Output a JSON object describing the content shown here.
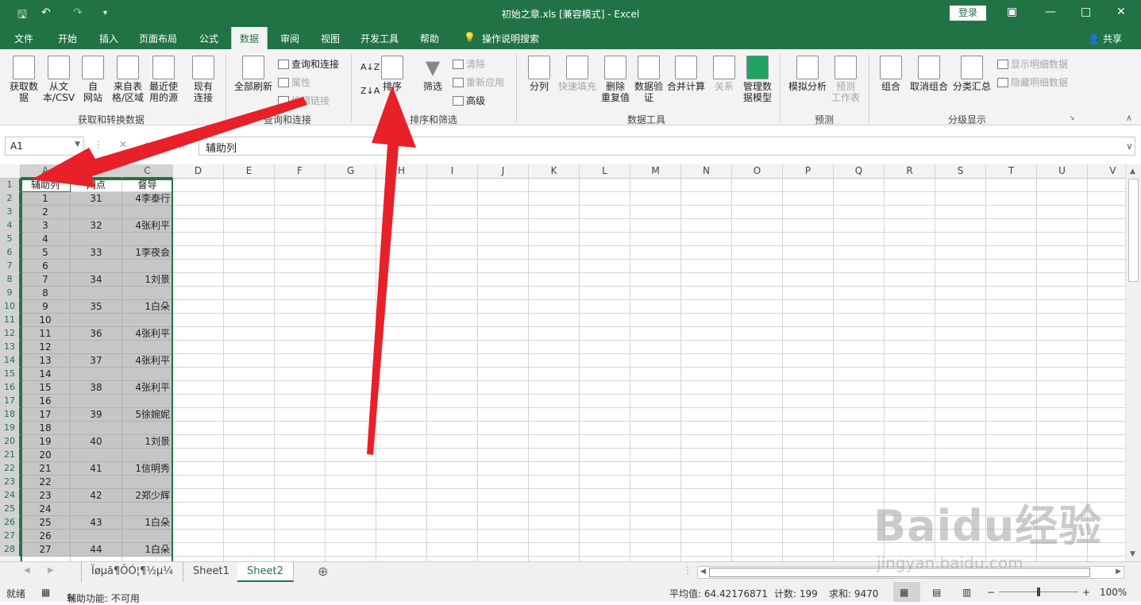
{
  "titlebar": {
    "title": "初始之章.xls  [兼容模式]  -  Excel",
    "login": "登录"
  },
  "tabs": [
    "文件",
    "开始",
    "插入",
    "页面布局",
    "公式",
    "数据",
    "审阅",
    "视图",
    "开发工具",
    "帮助",
    "操作说明搜索"
  ],
  "active_tab": "数据",
  "share": "共享",
  "ribbon": {
    "get_data": "获取数\n据",
    "from_csv": "从文\n本/CSV",
    "from_web": "自\n网站",
    "from_table": "来自表\n格/区域",
    "recent_sources": "最近使\n用的源",
    "existing": "现有\n连接",
    "group1": "获取和转换数据",
    "refresh_all": "全部刷新",
    "queries": "查询和连接",
    "properties": "属性",
    "edit_links": "编辑链接",
    "group2": "查询和连接",
    "sort_label": "排序",
    "filter_label": "筛选",
    "clear": "清除",
    "reapply": "重新应用",
    "advanced": "高级",
    "group3": "排序和筛选",
    "split": "分列",
    "flash_fill": "快速填充",
    "remove_dup": "删除\n重复值",
    "validation": "数据验\n证",
    "consolidate": "合并计算",
    "relations": "关系",
    "manage_model": "管理数\n据模型",
    "group4": "数据工具",
    "what_if": "模拟分析",
    "forecast_sheet": "预测\n工作表",
    "group5": "预测",
    "group_btn": "组合",
    "ungroup": "取消组合",
    "subtotal": "分类汇总",
    "show_detail": "显示明细数据",
    "hide_detail": "隐藏明细数据",
    "group6": "分级显示"
  },
  "formula": {
    "namebox": "A1",
    "content": "辅助列"
  },
  "columns": [
    "A",
    "B",
    "C",
    "D",
    "E",
    "F",
    "G",
    "H",
    "I",
    "J",
    "K",
    "L",
    "M",
    "N",
    "O",
    "P",
    "Q",
    "R",
    "S",
    "T",
    "U",
    "V"
  ],
  "rows": [
    {
      "n": "1",
      "a": "辅助列",
      "b": "网点",
      "c": "督导"
    },
    {
      "n": "2",
      "a": "1",
      "b": "31",
      "c": "4李泰行"
    },
    {
      "n": "3",
      "a": "2",
      "b": "",
      "c": ""
    },
    {
      "n": "4",
      "a": "3",
      "b": "32",
      "c": "4张利平"
    },
    {
      "n": "5",
      "a": "4",
      "b": "",
      "c": ""
    },
    {
      "n": "6",
      "a": "5",
      "b": "33",
      "c": "1李夜会"
    },
    {
      "n": "7",
      "a": "6",
      "b": "",
      "c": ""
    },
    {
      "n": "8",
      "a": "7",
      "b": "34",
      "c": "1刘景"
    },
    {
      "n": "9",
      "a": "8",
      "b": "",
      "c": ""
    },
    {
      "n": "10",
      "a": "9",
      "b": "35",
      "c": "1白朵"
    },
    {
      "n": "11",
      "a": "10",
      "b": "",
      "c": ""
    },
    {
      "n": "12",
      "a": "11",
      "b": "36",
      "c": "4张利平"
    },
    {
      "n": "13",
      "a": "12",
      "b": "",
      "c": ""
    },
    {
      "n": "14",
      "a": "13",
      "b": "37",
      "c": "4张利平"
    },
    {
      "n": "15",
      "a": "14",
      "b": "",
      "c": ""
    },
    {
      "n": "16",
      "a": "15",
      "b": "38",
      "c": "4张利平"
    },
    {
      "n": "17",
      "a": "16",
      "b": "",
      "c": ""
    },
    {
      "n": "18",
      "a": "17",
      "b": "39",
      "c": "5徐婉妮"
    },
    {
      "n": "19",
      "a": "18",
      "b": "",
      "c": ""
    },
    {
      "n": "20",
      "a": "19",
      "b": "40",
      "c": "1刘景"
    },
    {
      "n": "21",
      "a": "20",
      "b": "",
      "c": ""
    },
    {
      "n": "22",
      "a": "21",
      "b": "41",
      "c": "1信明秀"
    },
    {
      "n": "23",
      "a": "22",
      "b": "",
      "c": ""
    },
    {
      "n": "24",
      "a": "23",
      "b": "42",
      "c": "2郑少辉"
    },
    {
      "n": "25",
      "a": "24",
      "b": "",
      "c": ""
    },
    {
      "n": "26",
      "a": "25",
      "b": "43",
      "c": "1白朵"
    },
    {
      "n": "27",
      "a": "26",
      "b": "",
      "c": ""
    },
    {
      "n": "28",
      "a": "27",
      "b": "44",
      "c": "1白朵"
    }
  ],
  "sheets": [
    "Ïøµã¶ÔÓ¦¶½µ¼",
    "Sheet1",
    "Sheet2"
  ],
  "active_sheet": "Sheet2",
  "status": {
    "ready": "就绪",
    "accessibility": "辅助功能: 不可用",
    "average": "平均值: 64.42176871",
    "count": "计数: 199",
    "sum": "求和: 9470",
    "zoom": "100%"
  },
  "watermark": {
    "brand": "Baidu经验",
    "url": "jingyan.baidu.com"
  },
  "colors": {
    "excel_green": "#217346",
    "arrow_red": "#e8202a"
  }
}
